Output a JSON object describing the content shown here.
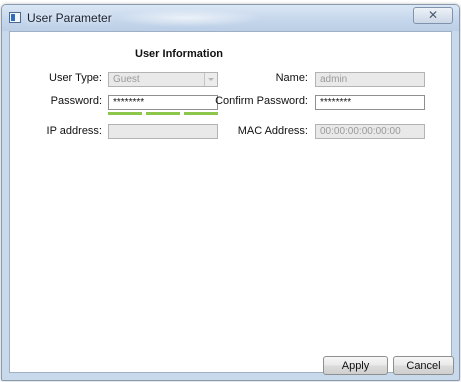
{
  "window": {
    "title": "User Parameter",
    "close_glyph": "✕"
  },
  "form": {
    "section_title": "User Information",
    "user_type": {
      "label": "User Type:",
      "value": "Guest"
    },
    "name": {
      "label": "Name:",
      "value": "admin"
    },
    "password": {
      "label": "Password:",
      "value": "********"
    },
    "confirm_password": {
      "label": "Confirm Password:",
      "value": "********"
    },
    "ip_address": {
      "label": "IP address:",
      "value": ""
    },
    "mac_address": {
      "label": "MAC Address:",
      "value": "00:00:00:00:00:00"
    },
    "password_strength_segments": 3
  },
  "buttons": {
    "apply": "Apply",
    "cancel": "Cancel"
  },
  "icons": {
    "app": "window-app-icon",
    "close": "close-icon",
    "dropdown": "chevron-down-icon"
  },
  "colors": {
    "strength_bar": "#8cc64a",
    "disabled_field": "#e9e9e9",
    "window_frame": "#c9d9ec"
  }
}
